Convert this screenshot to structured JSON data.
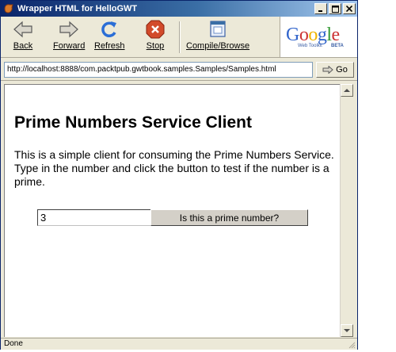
{
  "window": {
    "title": "Wrapper HTML for HelloGWT"
  },
  "toolbar": {
    "buttons": [
      {
        "label": "Back",
        "icon": "back-arrow-icon"
      },
      {
        "label": "Forward",
        "icon": "forward-arrow-icon"
      },
      {
        "label": "Refresh",
        "icon": "refresh-icon"
      },
      {
        "label": "Stop",
        "icon": "stop-icon"
      },
      {
        "label": "Compile/Browse",
        "icon": "compile-browse-icon"
      }
    ],
    "logo": {
      "word": "Google",
      "subtitle": "Web Toolkit",
      "badge": "BETA",
      "letter_colors": [
        "#3366cc",
        "#cc3333",
        "#f0b400",
        "#3366cc",
        "#339933",
        "#cc3333"
      ]
    }
  },
  "address": {
    "url": "http://localhost:8888/com.packtpub.gwtbook.samples.Samples/Samples.html",
    "go_label": "Go"
  },
  "page": {
    "title": "Prime Numbers Service Client",
    "intro": "This is a simple client for consuming the Prime Numbers Service. Type in the number and click the button to test if the number is a prime.",
    "number_value": "3",
    "check_button_label": "Is this a prime number?"
  },
  "status": {
    "text": "Done"
  },
  "colors": {
    "title_bar": "#0a246a",
    "chrome": "#ece9d8"
  }
}
